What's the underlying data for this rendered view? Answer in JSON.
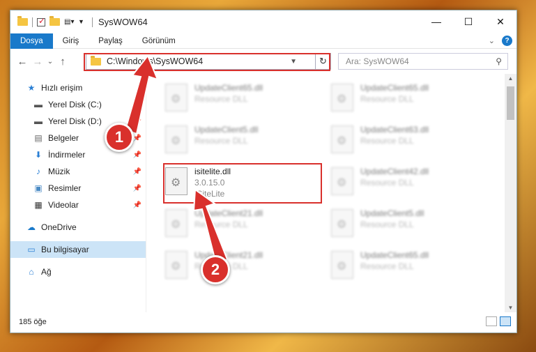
{
  "window": {
    "title": "SysWOW64",
    "minimize": "—",
    "maximize": "☐",
    "close": "✕"
  },
  "ribbon": {
    "tabs": [
      "Dosya",
      "Giriş",
      "Paylaş",
      "Görünüm"
    ]
  },
  "nav": {
    "back": "←",
    "forward": "→",
    "dropdown": "⌄",
    "up": "↑",
    "address": "C:\\Windows\\SysWOW64",
    "search_placeholder": "Ara: SysWOW64"
  },
  "sidebar": {
    "quick_access": "Hızlı erişim",
    "items": [
      "Yerel Disk (C:)",
      "Yerel Disk (D:)",
      "Belgeler",
      "İndirmeler",
      "Müzik",
      "Resimler",
      "Videolar"
    ],
    "onedrive": "OneDrive",
    "this_pc": "Bu bilgisayar",
    "network": "Ağ"
  },
  "files": [
    {
      "name": "UpdateClient65.dll",
      "desc": "Resource DLL"
    },
    {
      "name": "UpdateClient65.dll",
      "desc": "Resource DLL"
    },
    {
      "name": "UpdateClient5.dll",
      "desc": "Resource DLL"
    },
    {
      "name": "UpdateClient63.dll",
      "desc": "Resource DLL"
    },
    {
      "name": "UpdateClient42.dll",
      "desc": "Resource DLL"
    },
    {
      "name": "UpdateClient21.dll",
      "desc": "Resource DLL"
    },
    {
      "name": "UpdateClient5.dll",
      "desc": "Resource DLL"
    },
    {
      "name": "UpdateClient21.dll",
      "desc": "Resource DLL"
    },
    {
      "name": "UpdateClient65.dll",
      "desc": "Resource DLL"
    }
  ],
  "highlighted_file": {
    "name": "isitelite.dll",
    "version": "3.0.15.0",
    "desc": "ISiteLite"
  },
  "status": {
    "count": "185 öğe"
  },
  "annotations": {
    "step1": "1",
    "step2": "2",
    "color": "#d9302c"
  }
}
